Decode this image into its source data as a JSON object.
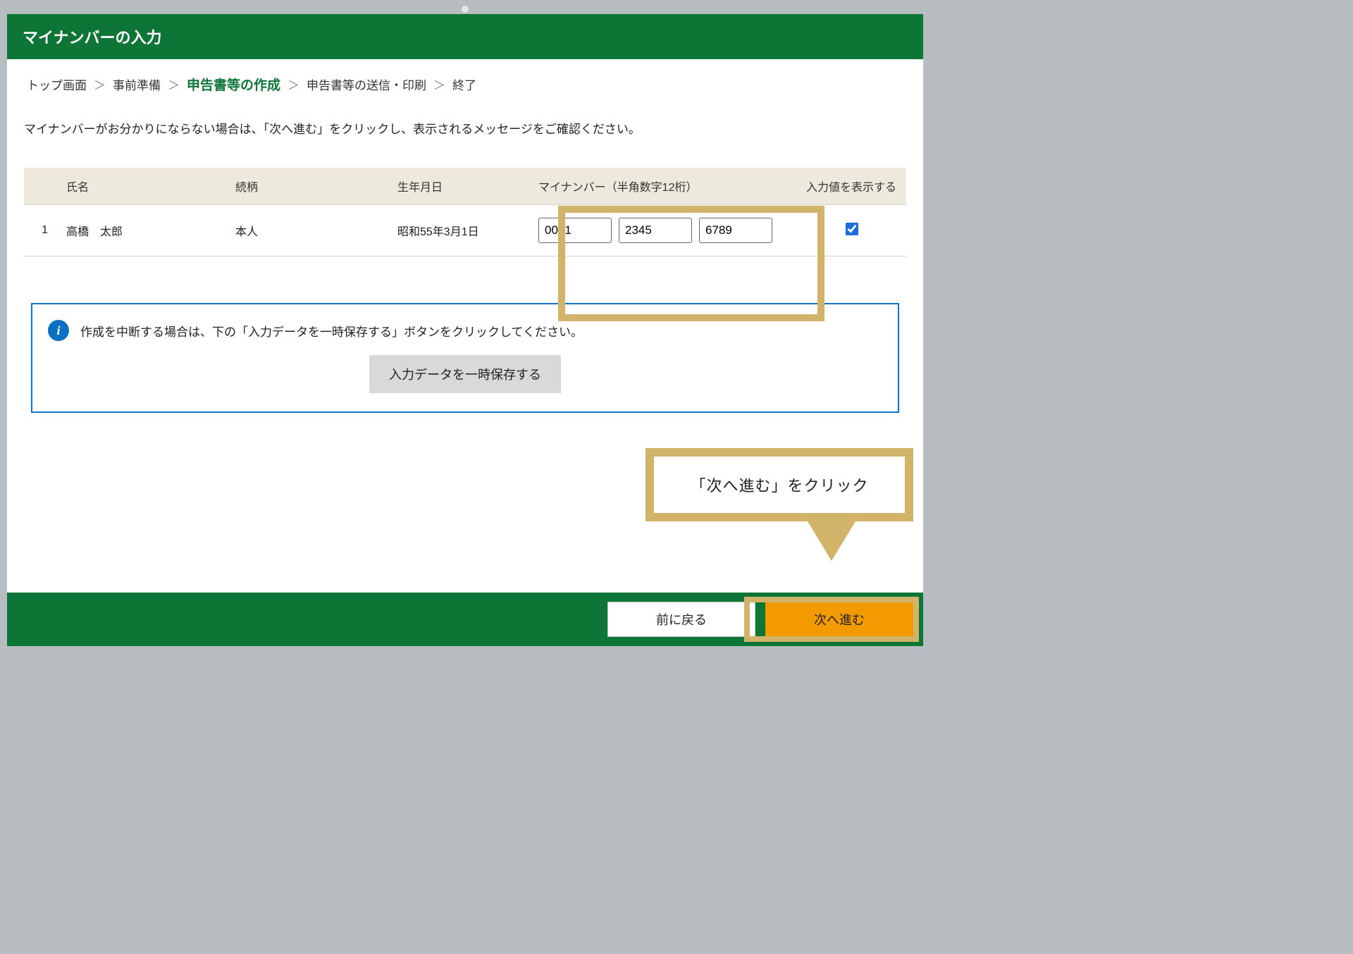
{
  "header": {
    "title": "マイナンバーの入力"
  },
  "breadcrumb": {
    "items": [
      {
        "label": "トップ画面",
        "active": false
      },
      {
        "label": "事前準備",
        "active": false
      },
      {
        "label": "申告書等の作成",
        "active": true
      },
      {
        "label": "申告書等の送信・印刷",
        "active": false
      },
      {
        "label": "終了",
        "active": false
      }
    ],
    "separator": "＞"
  },
  "instruction": "マイナンバーがお分かりにならない場合は、「次へ進む」をクリックし、表示されるメッセージをご確認ください。",
  "table": {
    "headers": {
      "index": "",
      "name": "氏名",
      "relation": "続柄",
      "birthdate": "生年月日",
      "mynumber": "マイナンバー（半角数字12桁）",
      "show": "入力値を表示する"
    },
    "rows": [
      {
        "index": "1",
        "name": "高橋　太郎",
        "relation": "本人",
        "birthdate": "昭和55年3月1日",
        "mynumber": [
          "0001",
          "2345",
          "6789"
        ],
        "show": true
      }
    ]
  },
  "info": {
    "text": "作成を中断する場合は、下の「入力データを一時保存する」ボタンをクリックしてください。",
    "save_button": "入力データを一時保存する"
  },
  "callout": {
    "text": "「次へ進む」をクリック"
  },
  "footer": {
    "back": "前に戻る",
    "next": "次へ進む"
  }
}
